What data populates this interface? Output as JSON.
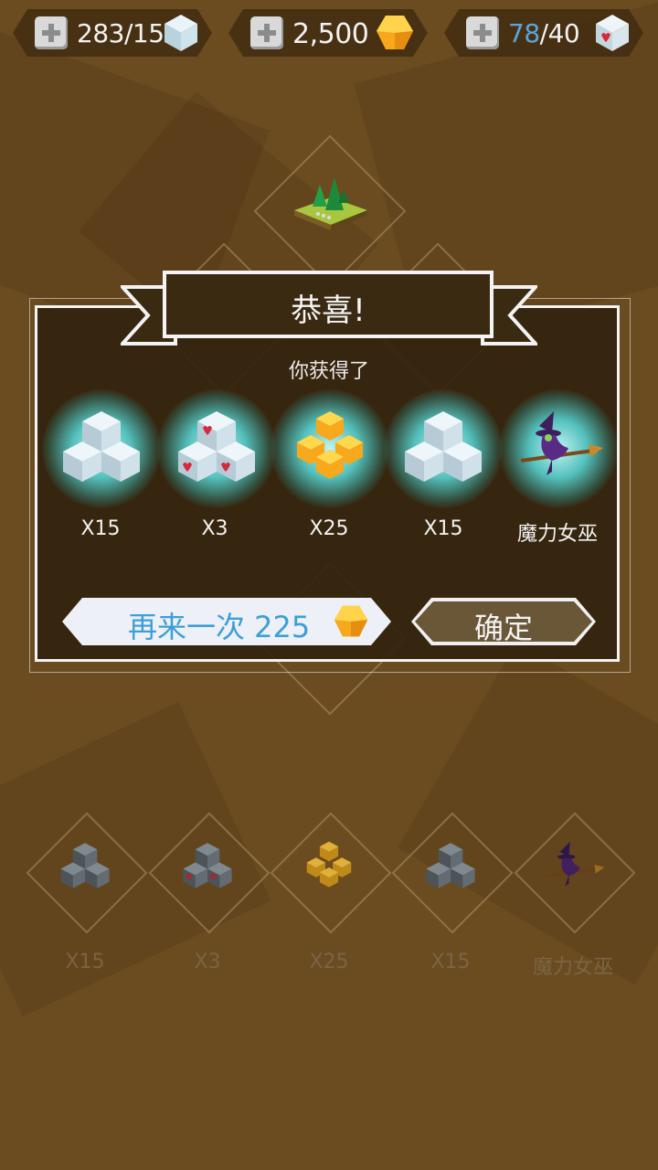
{
  "currencies": {
    "cubes": {
      "value": "283/15"
    },
    "gold": {
      "value": "2,500"
    },
    "hearts": {
      "current": "78",
      "max": "/40"
    }
  },
  "dialog": {
    "title": "恭喜!",
    "subtitle": "你获得了",
    "rewards": [
      {
        "icon": "silver-cubes-icon",
        "label": "X15"
      },
      {
        "icon": "heart-cubes-icon",
        "label": "X3"
      },
      {
        "icon": "gold-cubes-icon",
        "label": "X25"
      },
      {
        "icon": "silver-cubes-icon",
        "label": "X15"
      },
      {
        "icon": "witch-icon",
        "label": "魔力女巫"
      }
    ],
    "retry_button": {
      "label": "再来一次 225",
      "currency_icon": "gold-cube-icon"
    },
    "confirm_button": {
      "label": "确定"
    }
  },
  "reward_board": {
    "items": [
      {
        "icon": "gray-cubes-icon",
        "label": "X15"
      },
      {
        "icon": "heart-cubes-icon",
        "label": "X3"
      },
      {
        "icon": "gold-cubes-icon",
        "label": "X25"
      },
      {
        "icon": "gray-cubes-icon",
        "label": "X15"
      },
      {
        "icon": "witch-icon",
        "label": "魔力女巫"
      }
    ]
  },
  "colors": {
    "background": "#6b4c20",
    "accent_blue": "#3c9fd6",
    "gold": "#f5b21e"
  }
}
